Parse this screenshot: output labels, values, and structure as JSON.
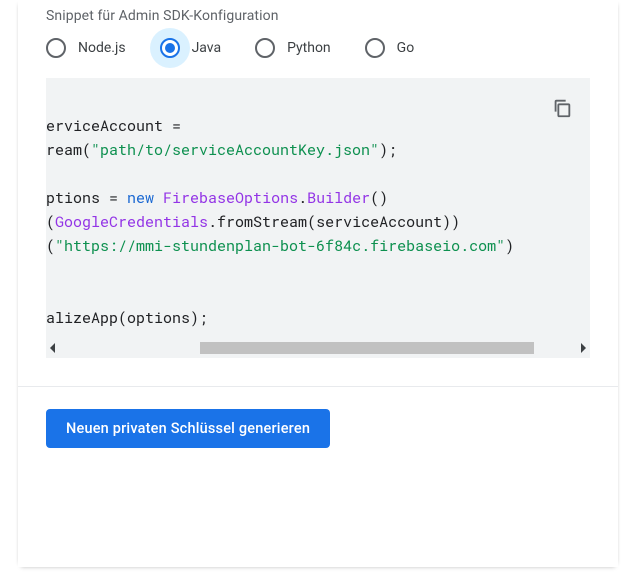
{
  "heading": "Snippet für Admin SDK-Konfiguration",
  "langs": [
    {
      "label": "Node.js",
      "selected": false
    },
    {
      "label": "Java",
      "selected": true
    },
    {
      "label": "Python",
      "selected": false
    },
    {
      "label": "Go",
      "selected": false
    }
  ],
  "code": {
    "line1_a": "erviceAccount =",
    "line2_a": "ream(",
    "line2_b": "\"path/to/serviceAccountKey.json\"",
    "line2_c": ");",
    "line3_blank": "",
    "line4_a": "ptions = ",
    "line4_b": "new",
    "line4_c": " ",
    "line4_d": "FirebaseOptions",
    "line4_e": ".",
    "line4_f": "Builder",
    "line4_g": "()",
    "line5_a": "(",
    "line5_b": "GoogleCredentials",
    "line5_c": ".fromStream(serviceAccount))",
    "line6_a": "(",
    "line6_b": "\"https://mmi-stundenplan-bot-6f84c.firebaseio.com\"",
    "line6_c": ")",
    "line7_blank": "",
    "line8_blank": "",
    "line9_a": "alizeApp(options);"
  },
  "footer": {
    "generate_label": "Neuen privaten Schlüssel generieren"
  }
}
